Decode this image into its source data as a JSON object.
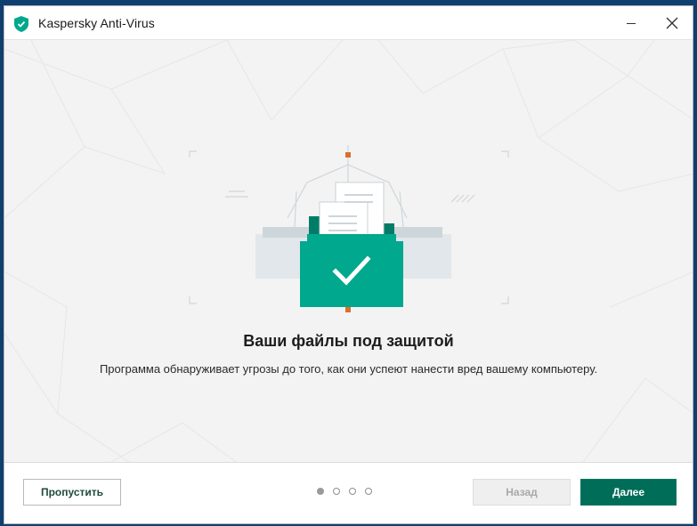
{
  "window": {
    "title": "Kaspersky Anti-Virus",
    "minimize_icon": "minimize-icon",
    "close_icon": "close-icon"
  },
  "main": {
    "headline": "Ваши файлы под защитой",
    "description": "Программа обнаруживает угрозы до того, как они успеют нанести вред вашему компьютеру.",
    "illustration_icon": "protected-folder-icon"
  },
  "footer": {
    "skip_label": "Пропустить",
    "back_label": "Назад",
    "next_label": "Далее",
    "pager": {
      "total": 4,
      "active_index": 0
    }
  },
  "colors": {
    "brand_green": "#00a88e",
    "dark_green": "#006d59",
    "accent_orange": "#d9702c",
    "disabled_text": "#a9a9a9"
  }
}
